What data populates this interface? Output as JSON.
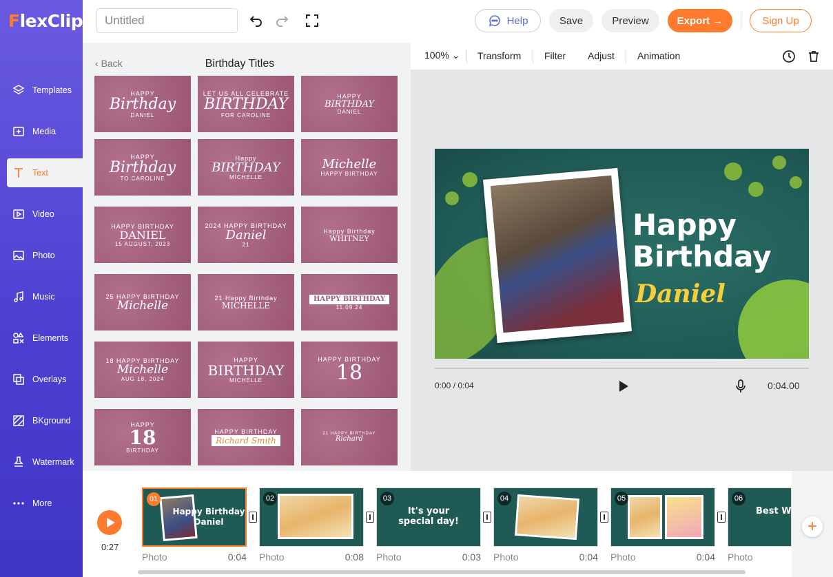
{
  "app": {
    "logo_first": "F",
    "logo_rest": "lexClip",
    "title": "Untitled"
  },
  "sidebar": {
    "items": [
      {
        "label": "Templates",
        "icon": "layers-icon"
      },
      {
        "label": "Media",
        "icon": "media-icon"
      },
      {
        "label": "Text",
        "icon": "text-icon",
        "active": true
      },
      {
        "label": "Video",
        "icon": "video-icon"
      },
      {
        "label": "Photo",
        "icon": "photo-icon"
      },
      {
        "label": "Music",
        "icon": "music-icon"
      },
      {
        "label": "Elements",
        "icon": "elements-icon"
      },
      {
        "label": "Overlays",
        "icon": "overlays-icon"
      },
      {
        "label": "BKground",
        "icon": "background-icon"
      },
      {
        "label": "Watermark",
        "icon": "watermark-icon"
      },
      {
        "label": "More",
        "icon": "more-icon"
      }
    ]
  },
  "topbar": {
    "help": "Help",
    "save": "Save",
    "preview": "Preview",
    "export": "Export →",
    "signup": "Sign Up"
  },
  "panel": {
    "back": "Back",
    "title": "Birthday Titles",
    "thumbs": [
      {
        "l1": "HAPPY",
        "l2": "Birthday",
        "l3": "DANIEL"
      },
      {
        "l1": "LET US ALL CELEBRATE",
        "l2": "BIRTHDAY",
        "l3": "FOR CAROLINE"
      },
      {
        "l1": "HAPPY",
        "l2": "BIRTHDAY",
        "l3": "DANIEL"
      },
      {
        "l1": "HAPPY",
        "l2": "Birthday",
        "l3": "TO CAROLINE"
      },
      {
        "l1": "Happy",
        "l2": "BIRTHDAY",
        "l3": "MICHELLE"
      },
      {
        "l1": "",
        "l2": "Michelle",
        "l3": "HAPPY BIRTHDAY"
      },
      {
        "l1": "HAPPY BIRTHDAY",
        "l2": "DANIEL",
        "l3": "15 AUGUST, 2023"
      },
      {
        "l1": "2024 HAPPY BIRTHDAY",
        "l2": "Daniel",
        "l3": "21"
      },
      {
        "l1": "Happy Birthday",
        "l2": "WHITNEY",
        "l3": ""
      },
      {
        "l1": "25 HAPPY BIRTHDAY",
        "l2": "Michelle",
        "l3": ""
      },
      {
        "l1": "21 Happy Birthday",
        "l2": "MICHELLE",
        "l3": ""
      },
      {
        "l1": "",
        "l2": "HAPPY BIRTHDAY",
        "l3": "11.09.24"
      },
      {
        "l1": "18 HAPPY BIRTHDAY",
        "l2": "Michelle",
        "l3": "AUG 18, 2024"
      },
      {
        "l1": "HAPPY",
        "l2": "BIRTHDAY",
        "l3": "MICHELLE"
      },
      {
        "l1": "HAPPY BIRTHDAY",
        "l2": "18",
        "l3": ""
      },
      {
        "l1": "HAPPY",
        "l2": "18",
        "l3": "BIRTHDAY"
      },
      {
        "l1": "HAPPY BIRTHDAY",
        "l2": "Richard Smith",
        "l3": ""
      },
      {
        "l1": "21 HAPPY BIRTHDAY",
        "l2": "Richard",
        "l3": ""
      }
    ]
  },
  "editbar": {
    "zoom": "100%",
    "transform": "Transform",
    "filter": "Filter",
    "adjust": "Adjust",
    "animation": "Animation"
  },
  "canvas": {
    "line1": "Happy",
    "line2": "Birthday",
    "name": "Daniel"
  },
  "player": {
    "time": "0:00 / 0:04",
    "duration": "0:04.00"
  },
  "timeline": {
    "time": "0:27",
    "clips": [
      {
        "num": "01",
        "label": "Photo",
        "dur": "0:04",
        "text": "Happy Birthday Daniel",
        "selected": true
      },
      {
        "num": "02",
        "label": "Photo",
        "dur": "0:08",
        "text": ""
      },
      {
        "num": "03",
        "label": "Photo",
        "dur": "0:03",
        "text": "It's your special day!"
      },
      {
        "num": "04",
        "label": "Photo",
        "dur": "0:04",
        "text": ""
      },
      {
        "num": "05",
        "label": "Photo",
        "dur": "0:04",
        "text": ""
      },
      {
        "num": "06",
        "label": "Photo",
        "dur": "",
        "text": "Best Wis"
      }
    ]
  },
  "colors": {
    "accent": "#ff7a2c",
    "sidebar": "#4b3fd1",
    "thumb": "#a2607b",
    "canvas": "#1f5a55"
  }
}
